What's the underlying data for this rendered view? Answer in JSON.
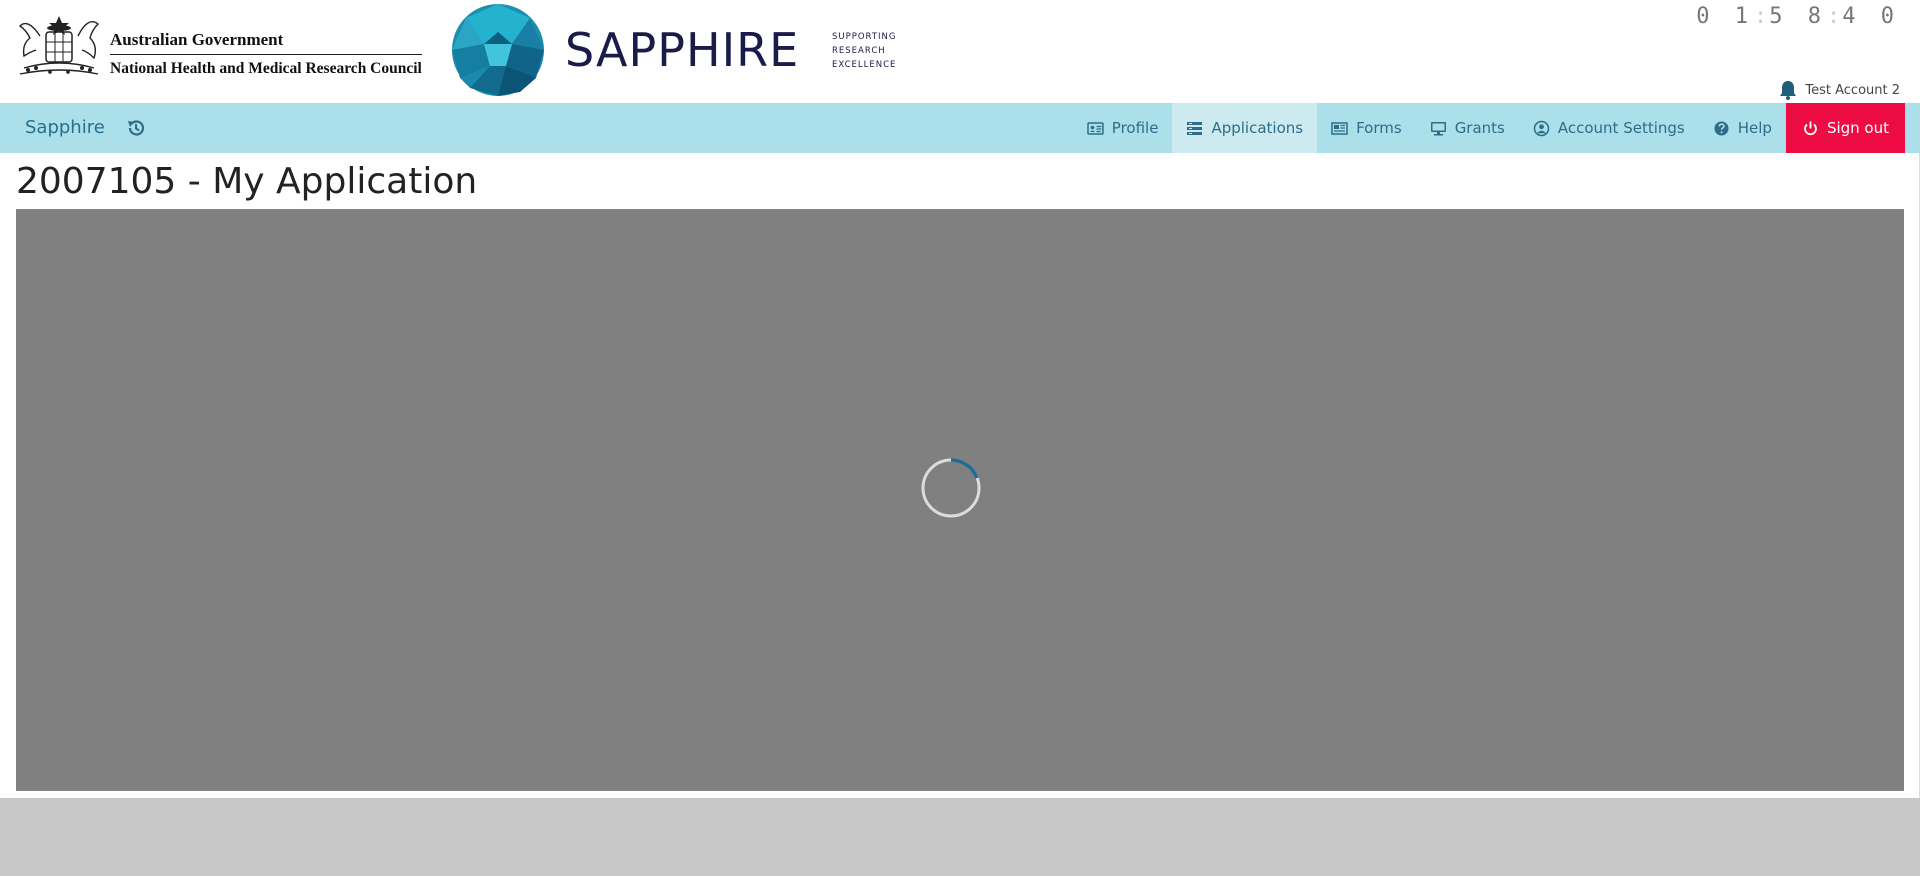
{
  "header": {
    "gov_line1": "Australian Government",
    "gov_line2": "National Health and Medical Research Council",
    "brand_name": "SAPPHIRE",
    "tagline": [
      "SUPPORTING",
      "RESEARCH",
      "EXCELLENCE"
    ],
    "timer": {
      "h": "0 1",
      "m": "5 8",
      "s": "4 0",
      "sep": ":"
    },
    "account_name": "Test Account 2"
  },
  "navbar": {
    "brand": "Sapphire",
    "items": [
      {
        "label": "Profile",
        "icon": "profile-card-icon"
      },
      {
        "label": "Applications",
        "icon": "list-icon",
        "active": true
      },
      {
        "label": "Forms",
        "icon": "newspaper-icon"
      },
      {
        "label": "Grants",
        "icon": "monitor-icon"
      },
      {
        "label": "Account Settings",
        "icon": "user-circle-icon"
      },
      {
        "label": "Help",
        "icon": "question-circle-icon"
      },
      {
        "label": "Sign out",
        "icon": "power-icon"
      }
    ]
  },
  "main": {
    "title": "2007105 - My Application"
  },
  "colors": {
    "navbar_bg": "#abdfea",
    "nav_text": "#2e6d87",
    "signout_bg": "#ee0c45",
    "brand_dark": "#1b1b4a",
    "loading_overlay": "#808080"
  }
}
